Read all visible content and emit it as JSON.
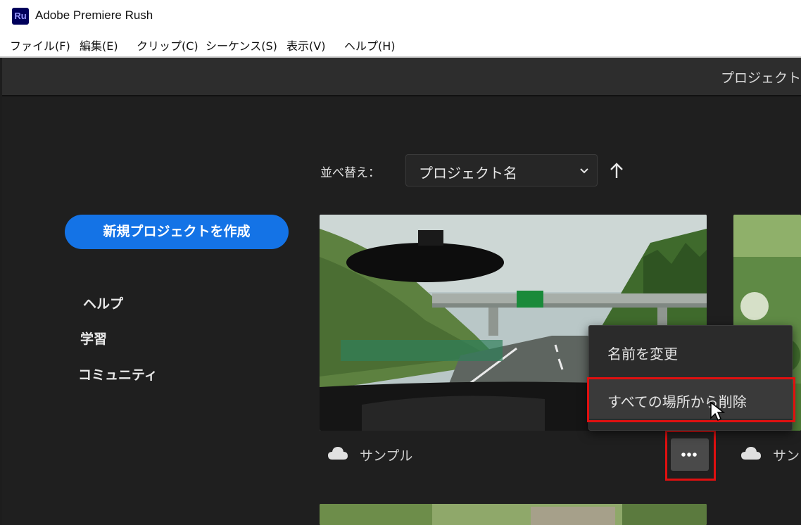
{
  "app": {
    "logo_text": "Ru",
    "title": "Adobe Premiere Rush"
  },
  "menu": [
    "ファイル(F)",
    "編集(E)",
    "クリップ(C)",
    "シーケンス(S)",
    "表示(V)",
    "ヘルプ(H)"
  ],
  "header": {
    "tab_label": "プロジェクト"
  },
  "sidebar": {
    "new_project": "新規プロジェクトを作成",
    "links": [
      "ヘルプ",
      "学習",
      "コミュニティ"
    ]
  },
  "sort": {
    "label": "並べ替え：",
    "value": "プロジェクト名",
    "direction_icon": "arrow-up-icon"
  },
  "projects": [
    {
      "name": "サンプル",
      "icon": "cloud-icon"
    },
    {
      "name": "サン",
      "icon": "cloud-icon"
    }
  ],
  "context_menu": {
    "items": [
      "名前を変更",
      "すべての場所から削除"
    ],
    "highlighted_index": 1
  },
  "colors": {
    "accent": "#1473e6",
    "annotation": "#e01010",
    "bg": "#1f1f1f"
  }
}
